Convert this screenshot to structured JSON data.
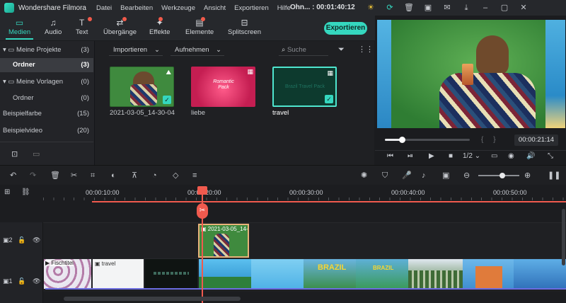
{
  "window": {
    "app_name": "Wondershare Filmora",
    "menu": [
      "Datei",
      "Bearbeiten",
      "Werkzeuge",
      "Ansicht",
      "Exportieren",
      "Hilfe"
    ],
    "project_title": "Ohn... : 00:01:40:12"
  },
  "toolbar": {
    "tabs": [
      {
        "label": "Medien",
        "icon": "folder-icon"
      },
      {
        "label": "Audio",
        "icon": "music-icon"
      },
      {
        "label": "Text",
        "icon": "text-icon"
      },
      {
        "label": "Übergänge",
        "icon": "transition-icon"
      },
      {
        "label": "Effekte",
        "icon": "effects-icon"
      },
      {
        "label": "Elemente",
        "icon": "elements-icon"
      },
      {
        "label": "Splitscreen",
        "icon": "splitscreen-icon"
      }
    ],
    "export_label": "Exportieren"
  },
  "sidebar": {
    "items": [
      {
        "label": "Meine Projekte",
        "count": "(3)"
      },
      {
        "label": "Ordner",
        "count": "(3)"
      },
      {
        "label": "Meine Vorlagen",
        "count": "(0)"
      },
      {
        "label": "Ordner",
        "count": "(0)"
      },
      {
        "label": "Beispielfarbe",
        "count": "(15)"
      },
      {
        "label": "Beispielvideo",
        "count": "(20)"
      }
    ]
  },
  "media": {
    "import_label": "Importieren",
    "record_label": "Aufnehmen",
    "search_placeholder": "Suche",
    "items": [
      {
        "name": "2021-03-05_14-30-04"
      },
      {
        "name": "liebe",
        "overlay": "Romantic\nPack"
      },
      {
        "name": "travel",
        "overlay": "Brazil Travel Pack"
      }
    ]
  },
  "preview": {
    "braces": "{     }",
    "timecode": "00:00:21:14",
    "speed": "1/2",
    "progress": 0.2
  },
  "timeline": {
    "ruler": [
      "00:00:10:00",
      "00:00:20:00",
      "00:00:30:00",
      "00:00:40:00",
      "00:00:50:00"
    ],
    "track2_clip": "2021-03-05_14-30-04",
    "track1_clips": [
      "Fischtitel",
      "travel",
      "BRAZIL",
      "BRAZIL"
    ],
    "track_labels": [
      "2",
      "1"
    ]
  },
  "colors": {
    "accent": "#35d7bf",
    "playhead": "#f05a4e"
  }
}
